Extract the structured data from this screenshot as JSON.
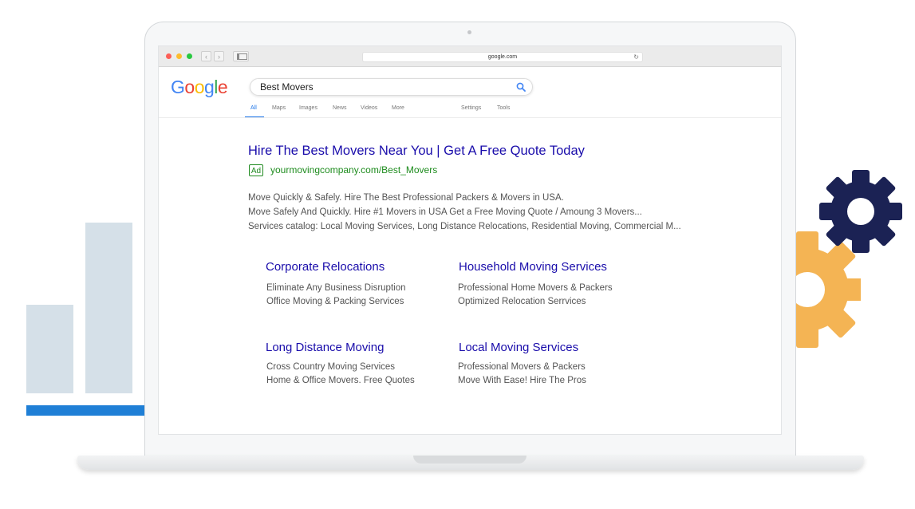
{
  "browser": {
    "url": "google.com"
  },
  "google_logo": [
    "G",
    "o",
    "o",
    "g",
    "l",
    "e"
  ],
  "search": {
    "query": "Best Movers"
  },
  "tabs": [
    "All",
    "Maps",
    "Images",
    "News",
    "Videos",
    "More",
    "Settings",
    "Tools"
  ],
  "ad": {
    "title": "Hire The Best Movers Near You | Get A Free Quote Today",
    "badge": "Ad",
    "url": "yourmovingcompany.com/Best_Movers",
    "descriptions": [
      "Move Quickly & Safely. Hire The Best Professional Packers & Movers in USA.",
      "Move Safely And Quickly. Hire #1 Movers in USA Get a Free Moving Quote / Amoung 3 Movers...",
      "Services catalog: Local Moving Services, Long Distance Relocations, Residential Moving, Commercial M..."
    ]
  },
  "sitelinks": [
    {
      "title": "Corporate Relocations",
      "lines": [
        "Eliminate Any Business Disruption",
        "Office Moving & Packing Services"
      ]
    },
    {
      "title": "Household Moving Services",
      "lines": [
        "Professional  Home Movers & Packers",
        "Optimized Relocation Serrvices"
      ]
    },
    {
      "title": "Long Distance Moving",
      "lines": [
        "Cross Country Moving Services",
        "Home & Office Movers. Free Quotes"
      ]
    },
    {
      "title": "Local Moving Services",
      "lines": [
        "Professional  Movers & Packers",
        "Move With Ease! Hire The Pros"
      ]
    }
  ],
  "colors": {
    "link_blue": "#1a0dab",
    "ad_green": "#1e8c1e",
    "accent_blue": "#1f7fd6",
    "gear_orange": "#f4b454",
    "gear_navy": "#1b2254",
    "bar_gray": "#d5e0e8"
  },
  "icons": {
    "search": "magnifier-icon",
    "reload": "reload-icon",
    "sidebar": "sidebar-toggle-icon",
    "gears": "gear-icon"
  }
}
